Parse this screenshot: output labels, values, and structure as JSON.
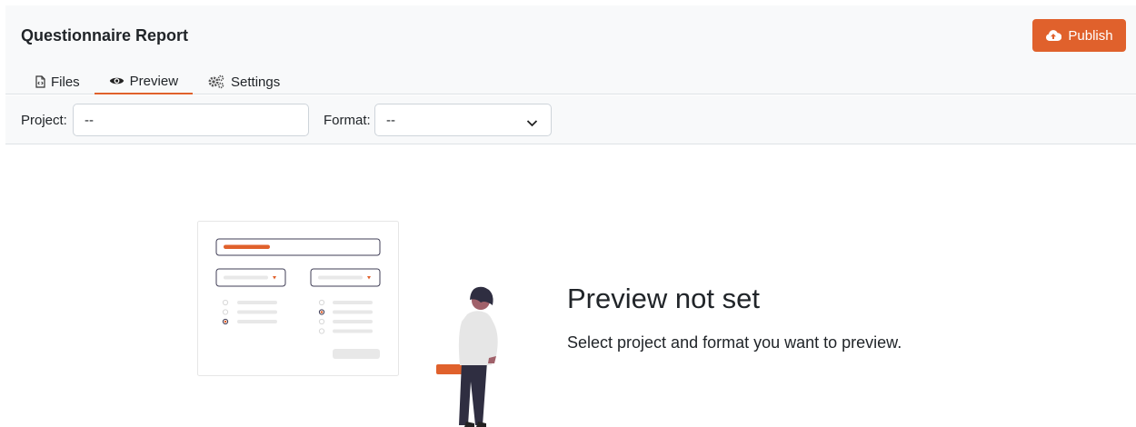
{
  "header": {
    "title": "Questionnaire Report",
    "publish_label": "Publish"
  },
  "tabs": [
    {
      "label": "Files",
      "icon": "file-code-icon",
      "active": false
    },
    {
      "label": "Preview",
      "icon": "eye-icon",
      "active": true
    },
    {
      "label": "Settings",
      "icon": "gears-icon",
      "active": false
    }
  ],
  "toolbar": {
    "project_label": "Project:",
    "project_value": "--",
    "format_label": "Format:",
    "format_value": "--"
  },
  "empty_state": {
    "title": "Preview not set",
    "subtitle": "Select project and format you want to preview."
  },
  "colors": {
    "accent": "#e0612c",
    "header_bg": "#f8f9fa",
    "border": "#dee2e6"
  }
}
